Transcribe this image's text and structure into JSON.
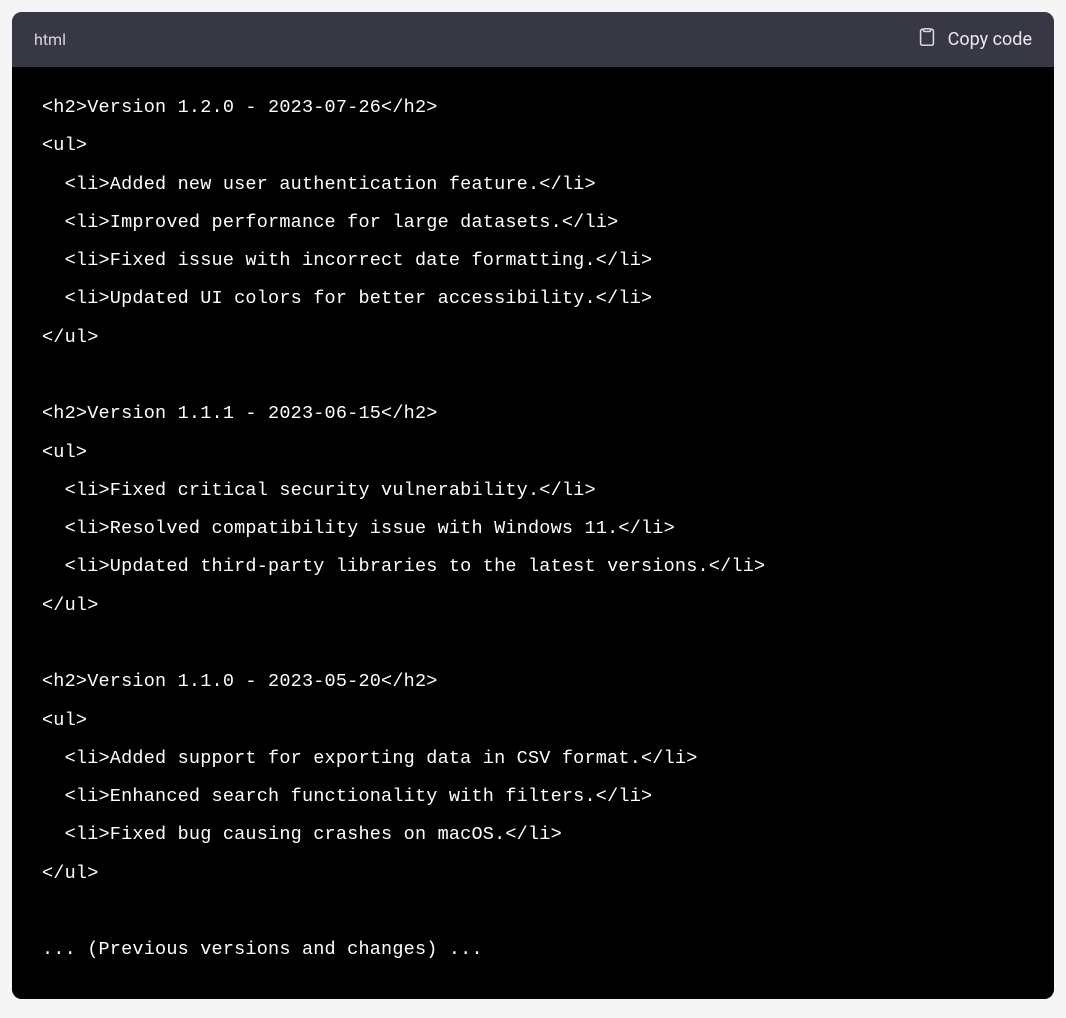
{
  "header": {
    "language": "html",
    "copy_label": "Copy code"
  },
  "code": {
    "versions": [
      {
        "heading": "<h2>Version 1.2.0 - 2023-07-26</h2>",
        "ul_open": "<ul>",
        "items": [
          "  <li>Added new user authentication feature.</li>",
          "  <li>Improved performance for large datasets.</li>",
          "  <li>Fixed issue with incorrect date formatting.</li>",
          "  <li>Updated UI colors for better accessibility.</li>"
        ],
        "ul_close": "</ul>"
      },
      {
        "heading": "<h2>Version 1.1.1 - 2023-06-15</h2>",
        "ul_open": "<ul>",
        "items": [
          "  <li>Fixed critical security vulnerability.</li>",
          "  <li>Resolved compatibility issue with Windows 11.</li>",
          "  <li>Updated third-party libraries to the latest versions.</li>"
        ],
        "ul_close": "</ul>"
      },
      {
        "heading": "<h2>Version 1.1.0 - 2023-05-20</h2>",
        "ul_open": "<ul>",
        "items": [
          "  <li>Added support for exporting data in CSV format.</li>",
          "  <li>Enhanced search functionality with filters.</li>",
          "  <li>Fixed bug causing crashes on macOS.</li>"
        ],
        "ul_close": "</ul>"
      }
    ],
    "footer": "... (Previous versions and changes) ..."
  }
}
